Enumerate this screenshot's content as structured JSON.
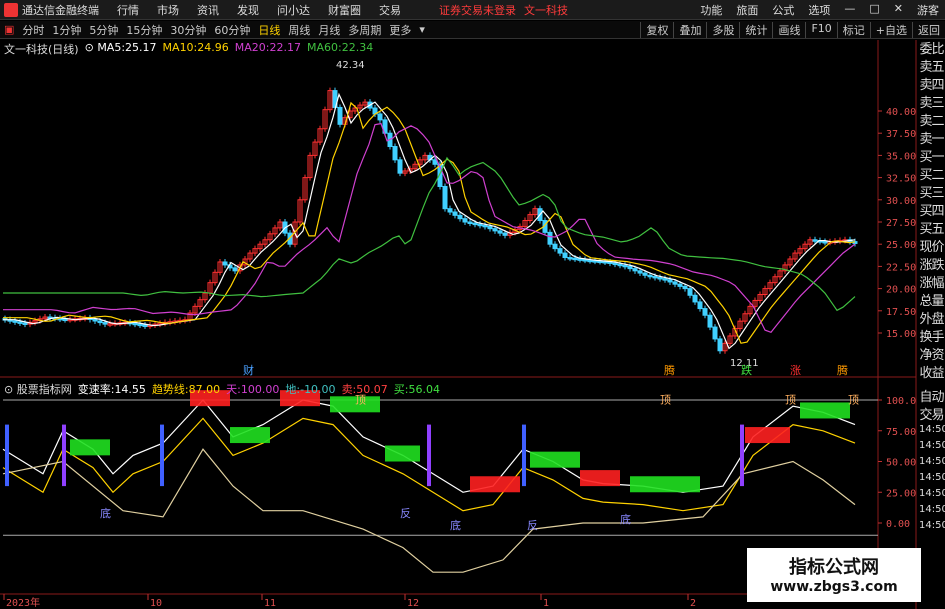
{
  "app": {
    "title": "通达信金融终端",
    "menus": [
      "行情",
      "市场",
      "资讯",
      "发现",
      "问小达",
      "财富圈",
      "交易"
    ],
    "notice": "证券交易未登录",
    "stock_tag": "文一科技",
    "right_menus": [
      "功能",
      "旅面",
      "公式",
      "选项"
    ],
    "guest": "游客"
  },
  "toolbar": {
    "periods": [
      "分时",
      "1分钟",
      "5分钟",
      "15分钟",
      "30分钟",
      "60分钟",
      "日线",
      "周线",
      "月线",
      "多周期",
      "更多"
    ],
    "active_period": "日线",
    "right_buttons": [
      "复权",
      "叠加",
      "多股",
      "统计",
      "画线",
      "F10",
      "标记",
      "+自选",
      "返回"
    ]
  },
  "main_chart": {
    "title": "文一科技(日线)",
    "ma": [
      {
        "label": "MA5:",
        "value": "25.17",
        "color": "#ffffff"
      },
      {
        "label": "MA10:",
        "value": "24.96",
        "color": "#ffd200"
      },
      {
        "label": "MA20:",
        "value": "22.17",
        "color": "#d040d0"
      },
      {
        "label": "MA60:",
        "value": "22.34",
        "color": "#40c040"
      }
    ],
    "price_axis": [
      "40.00",
      "37.50",
      "35.00",
      "32.50",
      "30.00",
      "27.50",
      "25.00",
      "22.50",
      "20.00",
      "17.50",
      "15.00"
    ],
    "annotations": {
      "high": "42.34",
      "low": "12.11"
    },
    "markers": [
      "财",
      "腾",
      "跌",
      "涨",
      "腾"
    ]
  },
  "sub_chart": {
    "title": "股票指标网",
    "items": [
      {
        "label": "变速率:",
        "value": "14.55",
        "color": "#ffffff"
      },
      {
        "label": "趋势线:",
        "value": "87.00",
        "color": "#ffd200"
      },
      {
        "label": "天:",
        "value": "100.00",
        "color": "#d040d0"
      },
      {
        "label": "地:",
        "value": "-10.00",
        "color": "#40c0c0"
      },
      {
        "label": "卖:",
        "value": "50.07",
        "color": "#ff4040"
      },
      {
        "label": "买:",
        "value": "56.04",
        "color": "#40e040"
      }
    ],
    "axis": [
      "100.0",
      "75.00",
      "50.00",
      "25.00",
      "0.00"
    ],
    "right_axis": [
      "14:50",
      "14:50",
      "14:50",
      "14:50",
      "14:50",
      "14:50",
      "14:50"
    ],
    "labels": [
      "底",
      "反",
      "底",
      "反",
      "底",
      "顶",
      "顶",
      "顶",
      "顶"
    ]
  },
  "date_axis": [
    "2023年",
    "10",
    "11",
    "12",
    "1",
    "2"
  ],
  "side_panel": [
    "委比",
    "卖五",
    "卖四",
    "卖三",
    "卖二",
    "卖一",
    "买一",
    "买二",
    "买三",
    "买四",
    "买五",
    "现价",
    "涨跌",
    "涨幅",
    "总量",
    "外盘",
    "换手",
    "净资",
    "收益"
  ],
  "side_panel_lower": [
    "自动",
    "交易"
  ],
  "watermark": {
    "line1": "指标公式网",
    "line2": "www.zbgs3.com"
  }
}
